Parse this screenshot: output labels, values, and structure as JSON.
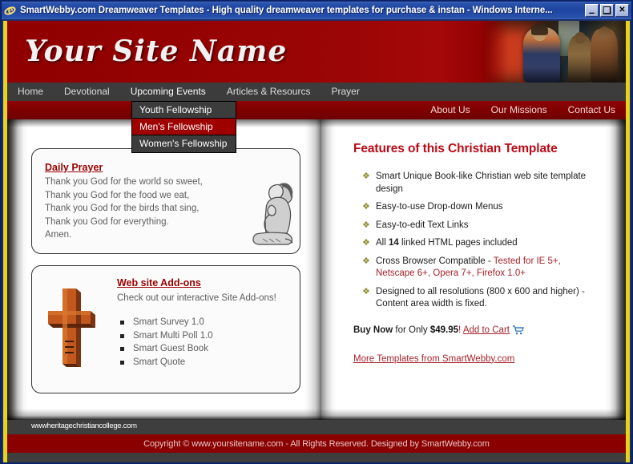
{
  "window": {
    "title": "SmartWebby.com Dreamweaver Templates - High quality dreamweaver templates for purchase & instan - Windows Interne...",
    "icon": "internet-explorer-icon",
    "minimize_label": "–",
    "maximize_label": "❑",
    "close_label": "✕"
  },
  "banner": {
    "site_name": "Your Site Name",
    "artwork": "jesus-painting-image"
  },
  "nav": {
    "primary": [
      {
        "label": "Home",
        "active": false
      },
      {
        "label": "Devotional",
        "active": false
      },
      {
        "label": "Upcoming Events",
        "active": true
      },
      {
        "label": "Articles & Resourcs",
        "active": false
      },
      {
        "label": "Prayer",
        "active": false
      }
    ],
    "dropdown": [
      {
        "label": "Youth Fellowship",
        "hover": false
      },
      {
        "label": "Men's Fellowship",
        "hover": true
      },
      {
        "label": "Women's Fellowship",
        "hover": false
      }
    ],
    "secondary": [
      {
        "label": "About Us"
      },
      {
        "label": "Our Missions"
      },
      {
        "label": "Contact Us"
      }
    ]
  },
  "left_page": {
    "prayer": {
      "heading": "Daily Prayer",
      "lines": [
        "Thank you God for the world so sweet,",
        "Thank you God for the food we eat,",
        "Thank you God for the birds that sing,",
        "Thank you God for everything.",
        "Amen."
      ],
      "image": "praying-child-image"
    },
    "addons": {
      "heading": "Web site Add-ons",
      "subtitle": "Check out our interactive Site Add-ons!",
      "image": "wooden-cross-image",
      "items": [
        "Smart Survey 1.0",
        "Smart Multi Poll 1.0",
        "Smart Guest Book",
        "Smart Quote"
      ]
    }
  },
  "right_page": {
    "title": "Features of this Christian Template",
    "features": [
      {
        "text": "Smart Unique Book-like Christian web site template design"
      },
      {
        "text": "Easy-to-use Drop-down Menus"
      },
      {
        "text": "Easy-to-edit Text Links"
      },
      {
        "text": "All 14 linked HTML pages included",
        "bold_part": "14"
      },
      {
        "text": "Cross Browser Compatible - Tested for IE 5+, Netscape 6+, Opera 7+, Firefox 1.0+",
        "plain_part": "Cross Browser Compatible - ",
        "accent_part": "Tested for IE 5+, Netscape 6+, Opera 7+, Firefox 1.0+"
      },
      {
        "text": "Designed to all resolutions (800 x 600 and higher) - Content area width is fixed."
      }
    ],
    "buy": {
      "bold_lead": "Buy Now",
      "mid": " for Only ",
      "price": "$49.95",
      "exclaim": "!",
      "cart_link": "Add to Cart",
      "cart_icon": "shopping-cart-icon"
    },
    "more_templates": "More Templates from SmartWebby.com"
  },
  "footer": {
    "watermark": "wwwheritagechristiancollege.com",
    "copyright": "Copyright © www.yoursitename.com - All Rights Reserved. Designed by SmartWebby.com"
  },
  "colors": {
    "brand_red": "#8a0000",
    "gold_border": "#e8d21a",
    "nav_gray": "#3c3c3c",
    "hover_red": "#9e0000",
    "link_red": "#a8222a",
    "heading_red": "#bb0a16"
  }
}
